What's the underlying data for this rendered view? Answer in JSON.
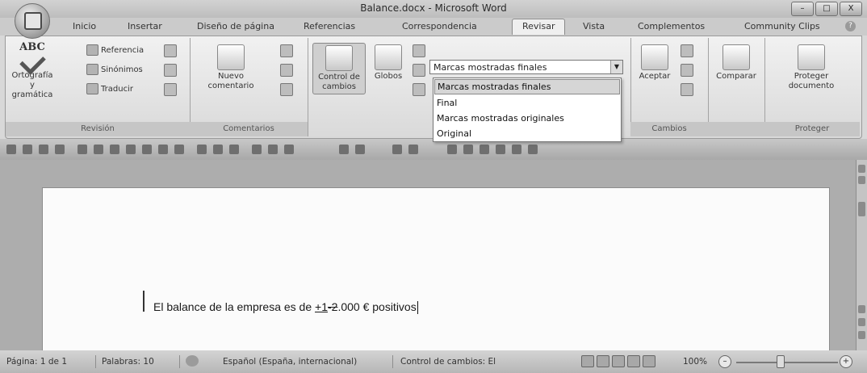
{
  "window": {
    "title": "Balance.docx - Microsoft Word",
    "controls": [
      "–",
      "□",
      "X"
    ]
  },
  "tabs": [
    "Inicio",
    "Insertar",
    "Diseño de página",
    "Referencias",
    "Correspondencia",
    "Revisar",
    "Vista",
    "Complementos",
    "Community Clips"
  ],
  "active_tab": "Revisar",
  "ribbon": {
    "revision": {
      "group_label": "Revisión",
      "spelling": "Ortografía\ny gramática",
      "spelling_icon_text": "ABC",
      "reference": "Referencia",
      "synonyms": "Sinónimos",
      "translate": "Traducir"
    },
    "comments": {
      "group_label": "Comentarios",
      "new_comment": "Nuevo\ncomentario"
    },
    "tracking": {
      "track_changes": "Control de\ncambios",
      "balloons": "Globos",
      "display_combo_value": "Marcas mostradas finales",
      "dropdown_options": [
        "Marcas mostradas finales",
        "Final",
        "Marcas mostradas originales",
        "Original"
      ]
    },
    "changes": {
      "group_label": "Cambios",
      "accept": "Aceptar"
    },
    "compare": {
      "compare": "Comparar"
    },
    "protect": {
      "group_label": "Proteger",
      "protect_document": "Proteger\ndocumento"
    }
  },
  "document": {
    "text_before": "El balance de la empresa es de ",
    "inserted": "+1",
    "deleted": "-2",
    "text_after": ".000 € positivos"
  },
  "status": {
    "page": "Página: 1 de 1",
    "words": "Palabras: 10",
    "language": "Español (España, internacional)",
    "track_changes": "Control de cambios: El",
    "zoom": "100%",
    "zoom_minus": "–",
    "zoom_plus": "+"
  }
}
